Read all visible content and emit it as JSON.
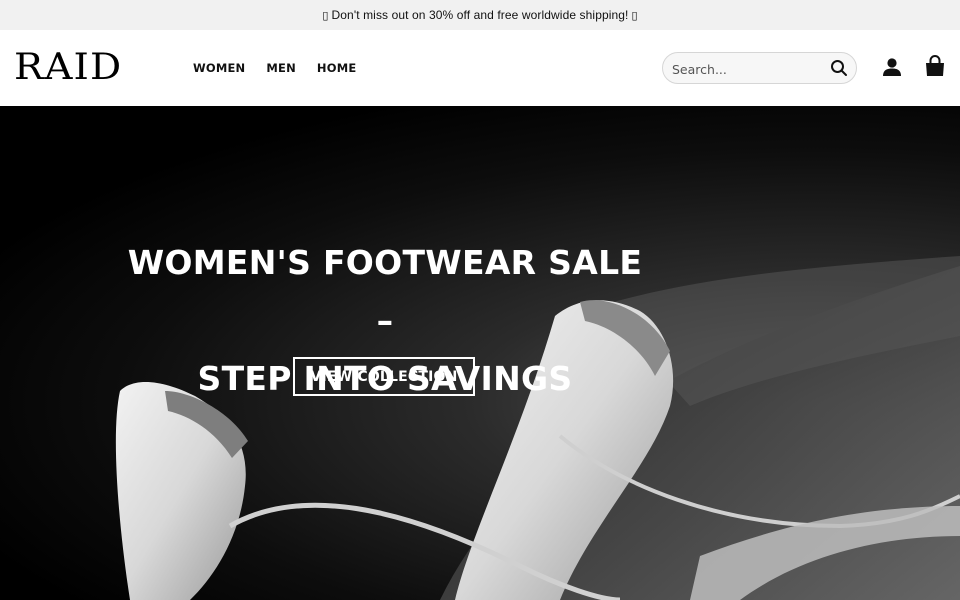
{
  "announcement": {
    "text": "Don't miss out on 30% off and free worldwide shipping!",
    "leading_glyph": "▯",
    "trailing_glyph": "▯"
  },
  "header": {
    "logo": "RAID",
    "nav": [
      {
        "label": "WOMEN"
      },
      {
        "label": "MEN"
      },
      {
        "label": "HOME"
      }
    ],
    "search": {
      "placeholder": "Search...",
      "value": ""
    },
    "icons": [
      "search-icon",
      "user-icon",
      "cart-icon"
    ]
  },
  "hero": {
    "title_line1": "WOMEN'S FOOTWEAR SALE –",
    "title_line2": "STEP INTO SAVINGS",
    "button_label": "VIEW COLLECTION"
  },
  "colors": {
    "topbar_bg": "#f1f1f1",
    "header_bg": "#ffffff",
    "text": "#111111",
    "hero_text": "#ffffff"
  }
}
